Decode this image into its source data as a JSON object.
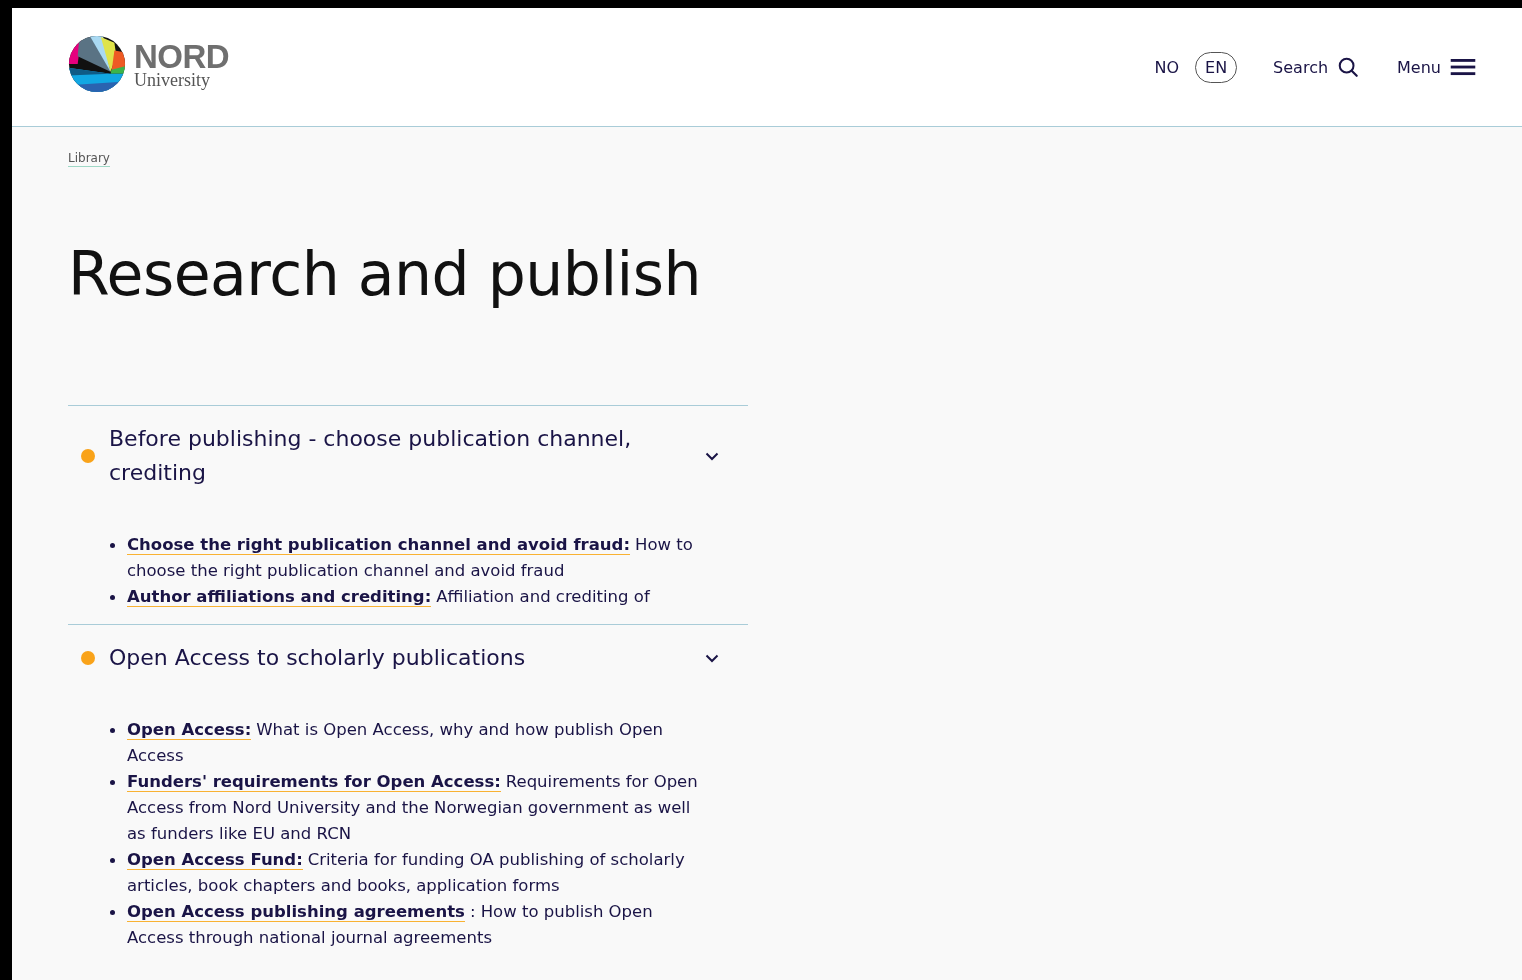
{
  "header": {
    "logo": {
      "name": "NORD",
      "subtitle": "University"
    },
    "languages": [
      {
        "label": "NO",
        "selected": false
      },
      {
        "label": "EN",
        "selected": true
      }
    ],
    "search": "Search",
    "menu": "Menu"
  },
  "breadcrumb": [
    "Library"
  ],
  "title": "Research and publish",
  "sections": [
    {
      "heading": "Before publishing - choose publication channel, crediting",
      "color": "#f9a31a",
      "expanded": true,
      "items": [
        {
          "link": "Choose the right publication channel and avoid fraud:",
          "text": "How to choose the right publication channel and avoid fraud"
        },
        {
          "link": "Author affiliations and crediting:",
          "text": "Affiliation and crediting of"
        }
      ]
    },
    {
      "heading": "Open Access to scholarly publications",
      "color": "#f9a31a",
      "expanded": true,
      "items": [
        {
          "link": "Open Access:",
          "text": "What is Open Access, why and how publish Open Access"
        },
        {
          "link": "Funders' requirements for Open Access:",
          "text": "Requirements for Open Access from Nord University and the Norwegian government as well as funders like EU and RCN"
        },
        {
          "link": "Open Access Fund:",
          "text": "Criteria for funding OA publishing of scholarly articles, book chapters and books, application forms"
        },
        {
          "link": "Open Access publishing agreements",
          "text": ": How to publish Open Access through national journal agreements"
        }
      ]
    }
  ]
}
